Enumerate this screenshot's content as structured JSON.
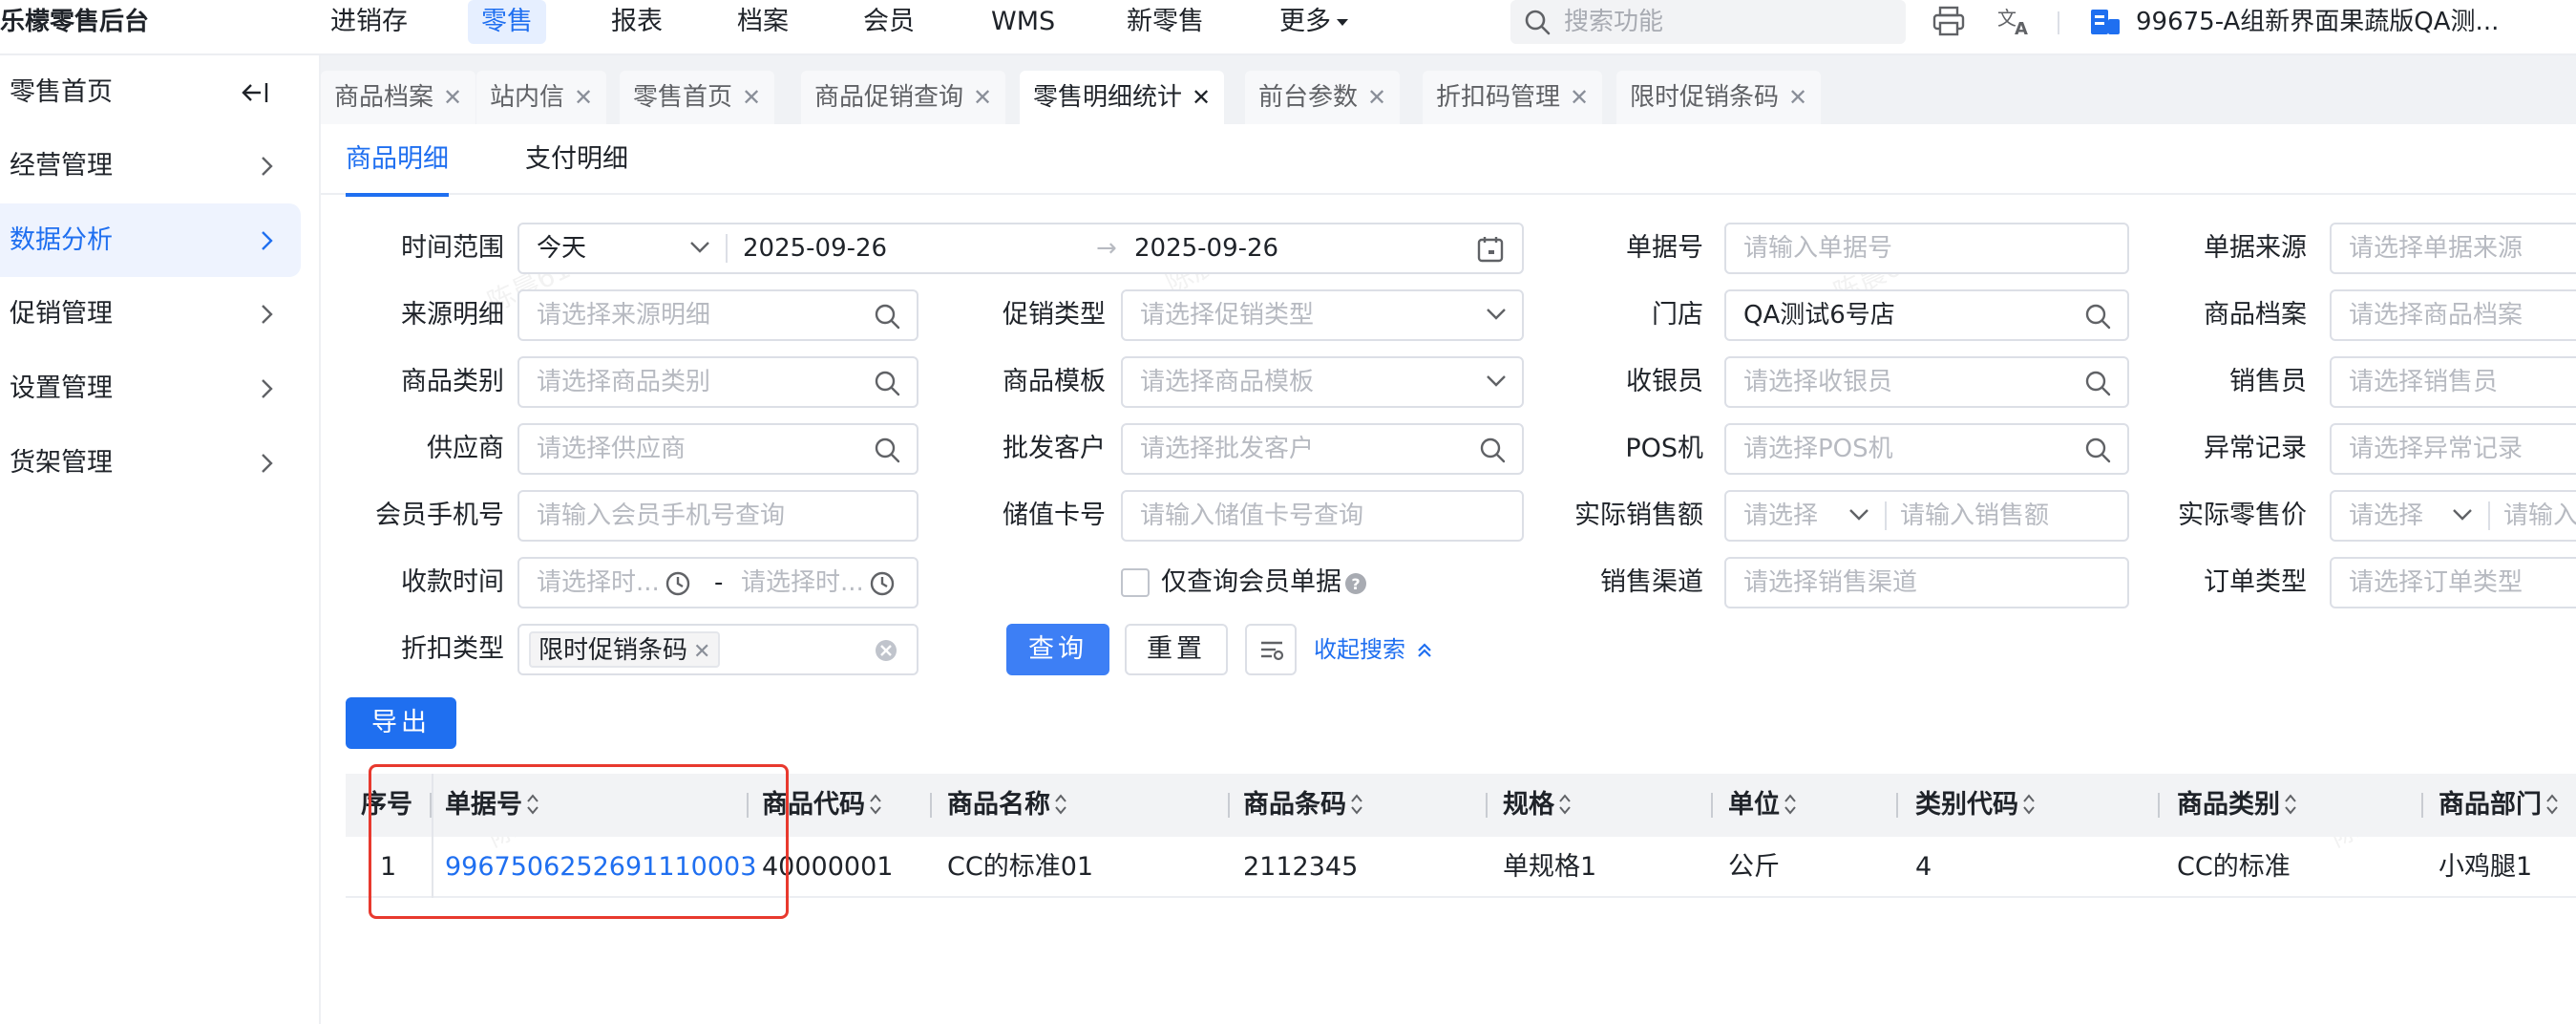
{
  "app": {
    "brand": "乐檬零售后台",
    "nav": [
      "进销存",
      "零售",
      "报表",
      "档案",
      "会员",
      "WMS",
      "新零售",
      "更多"
    ],
    "search_placeholder": "搜索功能",
    "store": "99675-A组新界面果蔬版QA测..."
  },
  "sidebar": {
    "items": [
      "零售首页",
      "经营管理",
      "数据分析",
      "促销管理",
      "设置管理",
      "货架管理"
    ],
    "active_index": 2
  },
  "tabs": [
    "商品档案",
    "站内信",
    "零售首页",
    "商品促销查询",
    "零售明细统计",
    "前台参数",
    "折扣码管理",
    "限时促销条码"
  ],
  "active_tab_index": 4,
  "subtabs": [
    "商品明细",
    "支付明细"
  ],
  "filters": {
    "time_range": {
      "label": "时间范围",
      "preset": "今天",
      "start": "2025-09-26",
      "end": "2025-09-26"
    },
    "bill_no": {
      "label": "单据号",
      "placeholder": "请输入单据号"
    },
    "bill_source": {
      "label": "单据来源",
      "placeholder": "请选择单据来源"
    },
    "source_detail": {
      "label": "来源明细",
      "placeholder": "请选择来源明细"
    },
    "promo_type": {
      "label": "促销类型",
      "placeholder": "请选择促销类型"
    },
    "store": {
      "label": "门店",
      "value": "QA测试6号店"
    },
    "item_file": {
      "label": "商品档案",
      "placeholder": "请选择商品档案"
    },
    "category": {
      "label": "商品类别",
      "placeholder": "请选择商品类别"
    },
    "template": {
      "label": "商品模板",
      "placeholder": "请选择商品模板"
    },
    "cashier": {
      "label": "收银员",
      "placeholder": "请选择收银员"
    },
    "salesman": {
      "label": "销售员",
      "placeholder": "请选择销售员"
    },
    "supplier": {
      "label": "供应商",
      "placeholder": "请选择供应商"
    },
    "wholesale": {
      "label": "批发客户",
      "placeholder": "请选择批发客户"
    },
    "pos": {
      "label": "POS机",
      "placeholder": "请选择POS机"
    },
    "anomaly": {
      "label": "异常记录",
      "placeholder": "请选择异常记录"
    },
    "member_phone": {
      "label": "会员手机号",
      "placeholder": "请输入会员手机号查询"
    },
    "stored_card": {
      "label": "储值卡号",
      "placeholder": "请输入储值卡号查询"
    },
    "actual_amount": {
      "label": "实际销售额",
      "op_placeholder": "请选择",
      "placeholder": "请输入销售额"
    },
    "actual_price": {
      "label": "实际零售价",
      "op_placeholder": "请选择",
      "placeholder": "请输入"
    },
    "pay_time": {
      "label": "收款时间",
      "start_placeholder": "请选择时...",
      "end_placeholder": "请选择时...",
      "sep": "-"
    },
    "member_only": {
      "label": "仅查询会员单据",
      "checked": false
    },
    "channel": {
      "label": "销售渠道",
      "placeholder": "请选择销售渠道"
    },
    "order_type": {
      "label": "订单类型",
      "placeholder": "请选择订单类型"
    },
    "discount_type": {
      "label": "折扣类型",
      "tag": "限时促销条码"
    }
  },
  "buttons": {
    "query": "查询",
    "reset": "重置",
    "collapse": "收起搜索",
    "export": "导出"
  },
  "table": {
    "headers": [
      "序号",
      "单据号",
      "商品代码",
      "商品名称",
      "商品条码",
      "规格",
      "单位",
      "类别代码",
      "商品类别",
      "商品部门"
    ],
    "rows": [
      [
        "1",
        "9967506252691110003",
        "40000001",
        "CC的标准01",
        "2112345",
        "单规格1",
        "公斤",
        "4",
        "CC的标准",
        "小鸡腿1"
      ]
    ]
  },
  "watermark": "陈晨6162"
}
